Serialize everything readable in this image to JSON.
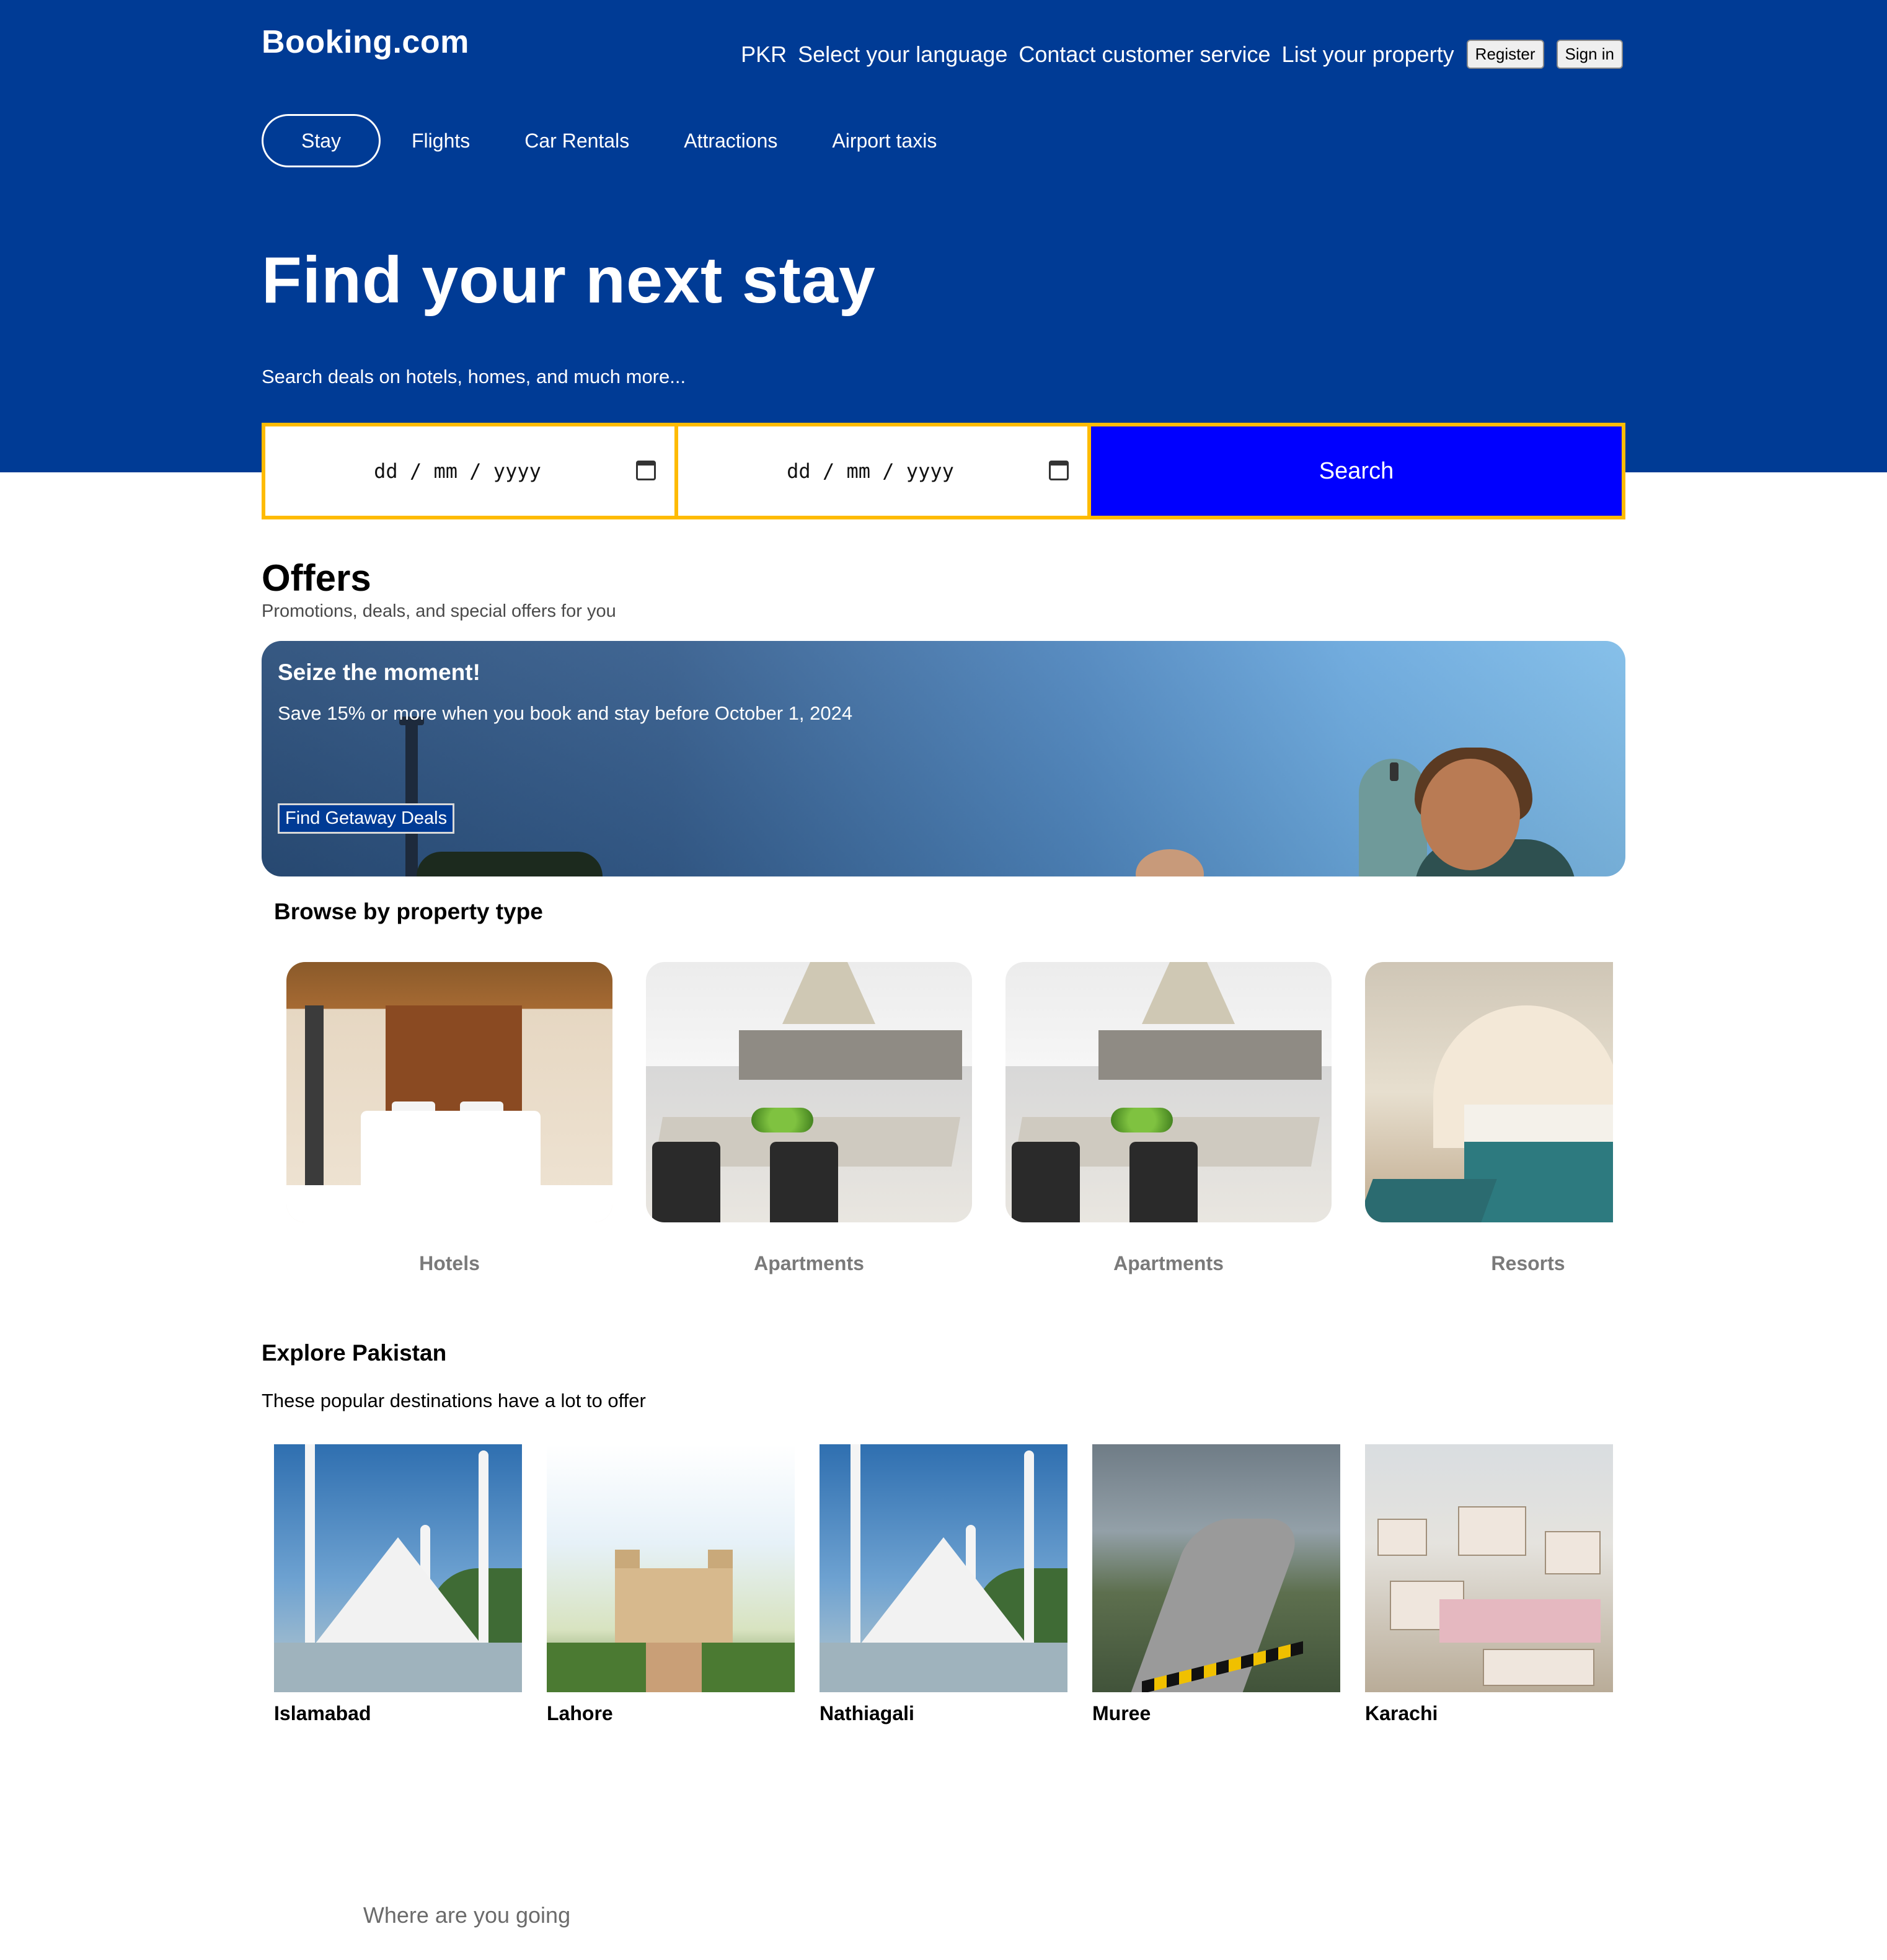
{
  "header": {
    "logo": "Booking.com",
    "nav": {
      "currency": "PKR",
      "language": "Select your language",
      "contact": "Contact customer service",
      "list_property": "List your property",
      "register": "Register",
      "sign_in": "Sign in"
    },
    "tabs": [
      {
        "label": "Stay",
        "active": true
      },
      {
        "label": "Flights",
        "active": false
      },
      {
        "label": "Car Rentals",
        "active": false
      },
      {
        "label": "Attractions",
        "active": false
      },
      {
        "label": "Airport taxis",
        "active": false
      }
    ]
  },
  "hero": {
    "title": "Find your next stay",
    "subtitle": "Search deals on hotels, homes, and much more..."
  },
  "search": {
    "destination_placeholder": "Where are you going",
    "checkin_placeholder": "dd / mm / yyyy",
    "checkout_placeholder": "dd / mm / yyyy",
    "button": "Search"
  },
  "offers": {
    "title": "Offers",
    "subtitle": "Promotions, deals, and special offers for you",
    "banner": {
      "heading": "Seize the moment!",
      "text": "Save 15% or more when you book and stay before October 1, 2024",
      "button": "Find Getaway Deals"
    }
  },
  "browse": {
    "title": "Browse by property type",
    "items": [
      {
        "label": "Hotels"
      },
      {
        "label": "Apartments"
      },
      {
        "label": "Apartments"
      },
      {
        "label": "Resorts"
      }
    ]
  },
  "explore": {
    "title": "Explore Pakistan",
    "subtitle": "These popular destinations have a lot to offer",
    "destinations": [
      {
        "name": "Islamabad"
      },
      {
        "name": "Lahore"
      },
      {
        "name": "Nathiagali"
      },
      {
        "name": "Muree"
      },
      {
        "name": "Karachi"
      }
    ]
  },
  "colors": {
    "brand_blue": "#003b95",
    "search_border": "#febb02",
    "search_button": "#0000ff"
  },
  "icons": {
    "date_picker": "calendar-icon"
  }
}
